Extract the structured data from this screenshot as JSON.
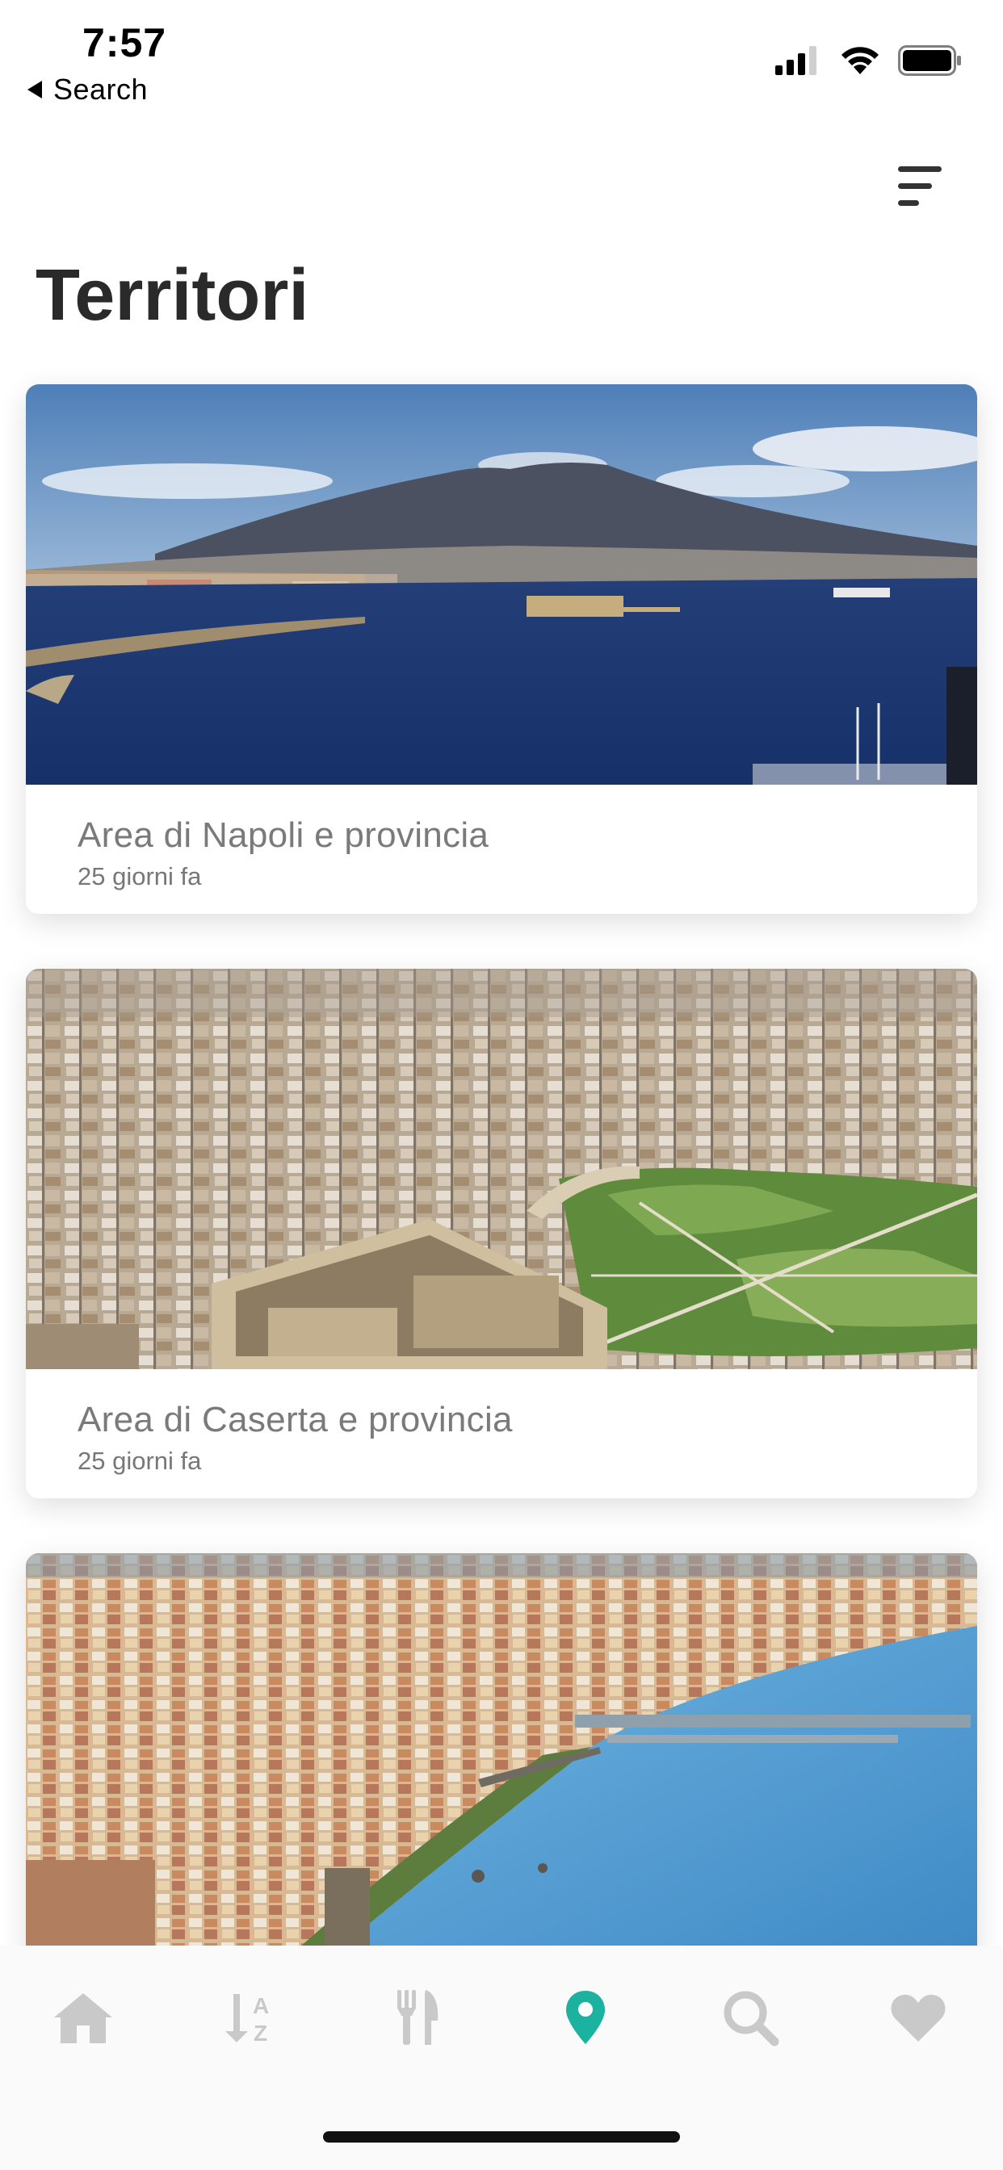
{
  "status": {
    "time": "7:57",
    "back_label": "Search"
  },
  "header": {
    "title": "Territori"
  },
  "cards": [
    {
      "title": "Area di Napoli e provincia",
      "date": "25 giorni fa"
    },
    {
      "title": "Area di Caserta e provincia",
      "date": "25 giorni fa"
    },
    {
      "title": "",
      "date": ""
    }
  ],
  "tabs": [
    {
      "icon": "home-icon",
      "active": false
    },
    {
      "icon": "sort-az-icon",
      "active": false
    },
    {
      "icon": "fork-knife-icon",
      "active": false
    },
    {
      "icon": "map-pin-icon",
      "active": true
    },
    {
      "icon": "search-icon",
      "active": false
    },
    {
      "icon": "heart-icon",
      "active": false
    }
  ],
  "colors": {
    "accent": "#1bb3a0",
    "tab_inactive": "#c9c9c9",
    "title": "#2a2a2a"
  }
}
